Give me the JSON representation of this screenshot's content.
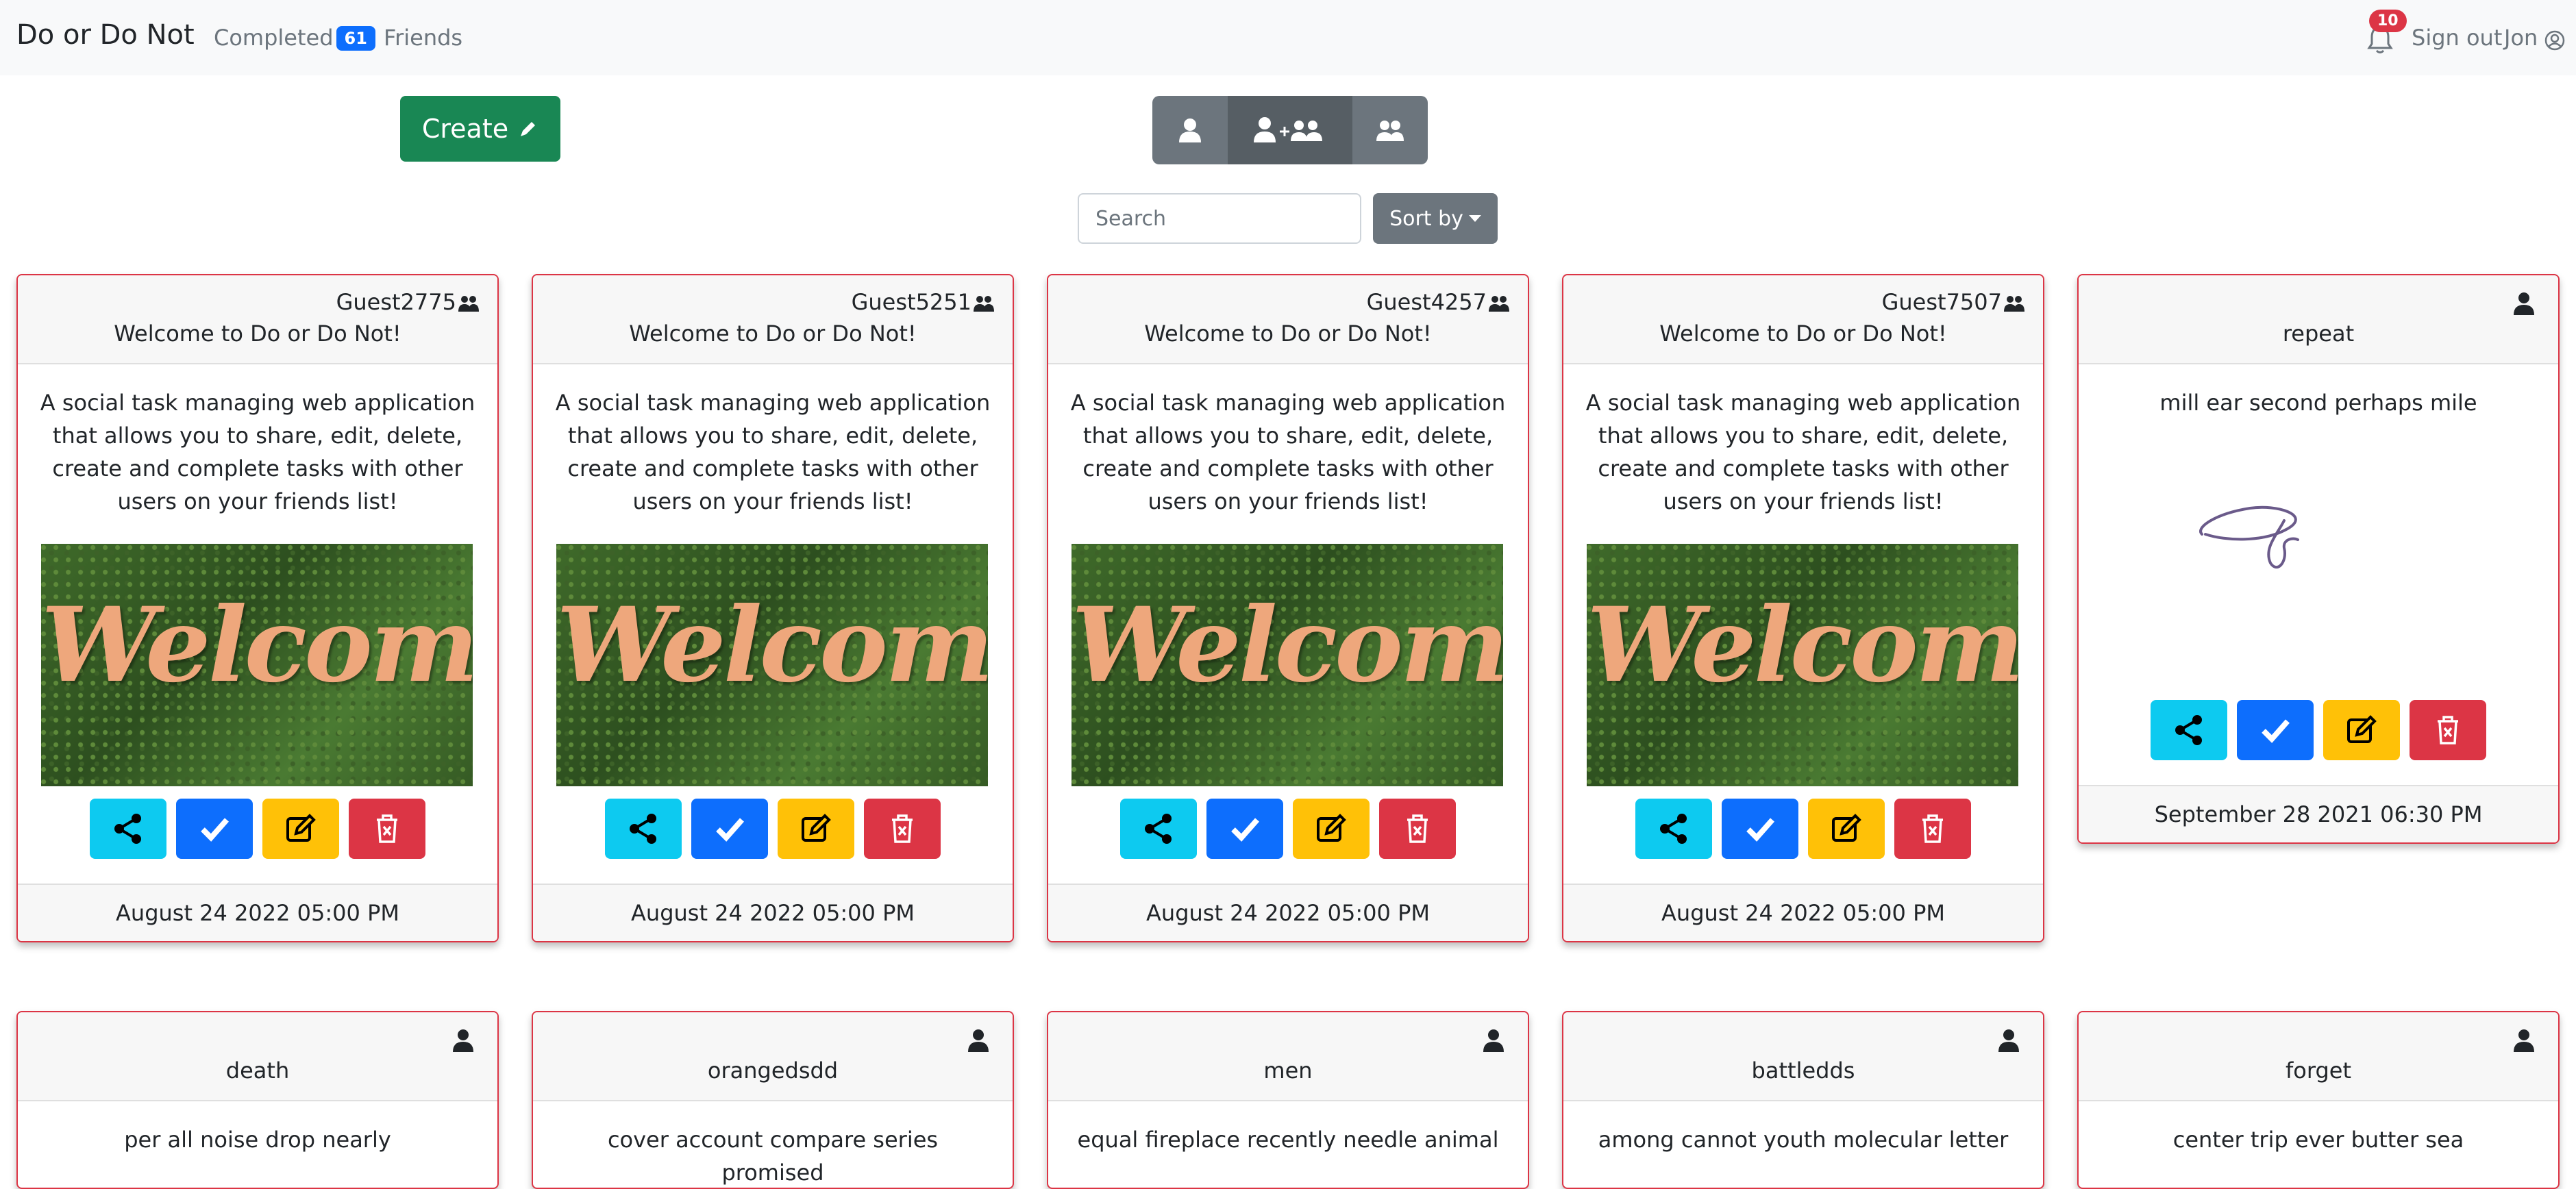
{
  "nav": {
    "brand": "Do or Do Not",
    "completed_label": "Completed",
    "completed_count": "61",
    "friends_label": "Friends",
    "notification_count": "10",
    "signout_label": "Sign out",
    "user_label": "Jon"
  },
  "toolbar": {
    "create_label": "Create",
    "search_placeholder": "Search",
    "sort_label": "Sort by",
    "view_modes": [
      "my-tasks",
      "mine-and-shared",
      "shared"
    ],
    "active_view": "mine-and-shared"
  },
  "cards": [
    {
      "owner": "Guest2775",
      "title": "Welcome to Do or Do Not!",
      "body": "A social task managing web application that allows you to share, edit, delete, create and complete tasks with other users on your friends list!",
      "image_text": "Welcome",
      "date": "August 24 2022 05:00 PM"
    },
    {
      "owner": "Guest5251",
      "title": "Welcome to Do or Do Not!",
      "body": "A social task managing web application that allows you to share, edit, delete, create and complete tasks with other users on your friends list!",
      "image_text": "Welcome",
      "date": "August 24 2022 05:00 PM"
    },
    {
      "owner": "Guest4257",
      "title": "Welcome to Do or Do Not!",
      "body": "A social task managing web application that allows you to share, edit, delete, create and complete tasks with other users on your friends list!",
      "image_text": "Welcome",
      "date": "August 24 2022 05:00 PM"
    },
    {
      "owner": "Guest7507",
      "title": "Welcome to Do or Do Not!",
      "body": "A social task managing web application that allows you to share, edit, delete, create and complete tasks with other users on your friends list!",
      "image_text": "Welcome",
      "date": "August 24 2022 05:00 PM"
    },
    {
      "title": "repeat",
      "body": "mill ear second perhaps mile",
      "date": "September 28 2021 06:30 PM"
    }
  ],
  "row2": [
    {
      "title": "death",
      "body": "per all noise drop nearly"
    },
    {
      "title": "orangedsdd",
      "body": "cover account compare series promised"
    },
    {
      "title": "men",
      "body": "equal fireplace recently needle animal"
    },
    {
      "title": "battledds",
      "body": "among cannot youth molecular letter"
    },
    {
      "title": "forget",
      "body": "center trip ever butter sea"
    }
  ],
  "colors": {
    "share": "#0dcaf0",
    "complete": "#0d6efd",
    "edit": "#ffc107",
    "delete": "#dc3545",
    "create": "#198754",
    "card_border": "#dc3545"
  }
}
